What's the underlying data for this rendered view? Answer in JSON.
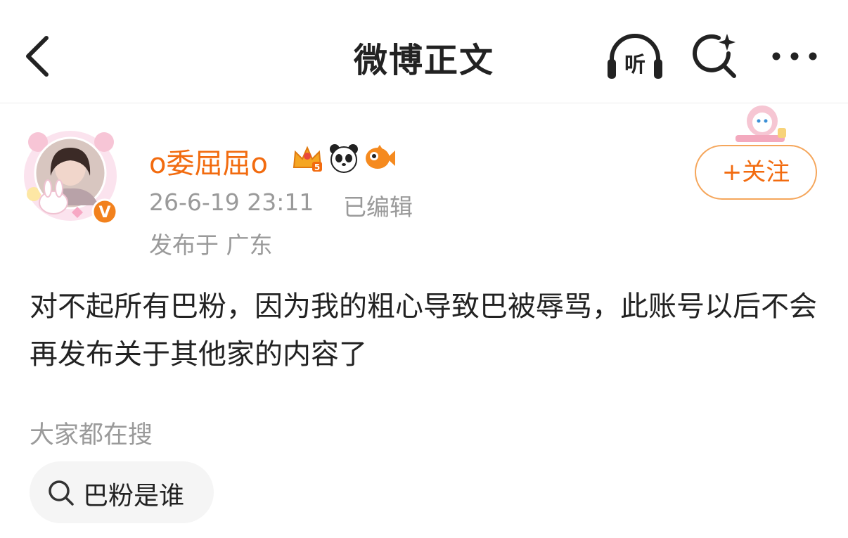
{
  "header": {
    "title": "微博正文",
    "listen_label": "听"
  },
  "post": {
    "author": {
      "name": "o委屈屈o",
      "verified_mark": "V",
      "level_badge": "5"
    },
    "timestamp": "26-6-19 23:11",
    "edited_label": "已编辑",
    "location": "发布于 广东",
    "follow_label": "+关注",
    "content": "对不起所有巴粉，因为我的粗心导致巴被辱骂，此账号以后不会再发布关于其他家的内容了"
  },
  "trending": {
    "heading": "大家都在搜",
    "items": [
      {
        "label": "巴粉是谁"
      }
    ]
  },
  "colors": {
    "accent": "#f26b0f",
    "follow_border": "#f5a65b",
    "muted_text": "#9a9a9a",
    "chip_bg": "#f5f5f5"
  },
  "icons": {
    "back": "chevron-left-icon",
    "listen": "headphones-icon",
    "search": "search-sparkle-icon",
    "more": "more-dots-icon"
  }
}
